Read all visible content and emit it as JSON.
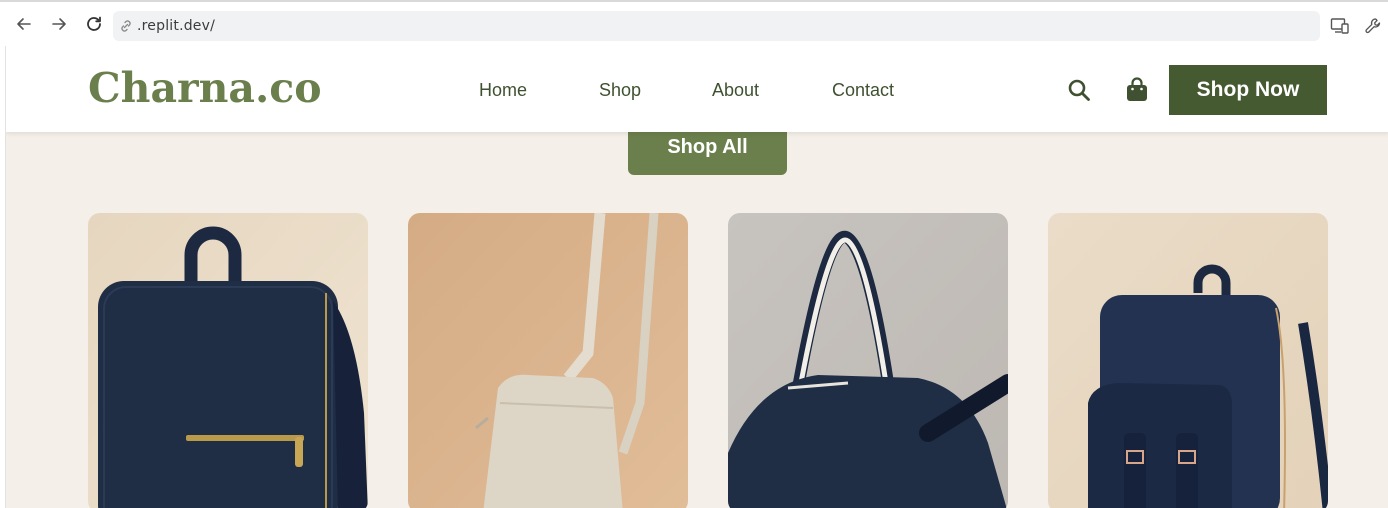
{
  "browser": {
    "url": ".replit.dev/",
    "icons": {
      "back": "arrow-left-icon",
      "forward": "arrow-right-icon",
      "reload": "reload-icon",
      "site_info": "link-icon",
      "device_toolbar": "device-toggle-icon",
      "devtools": "wrench-icon"
    }
  },
  "site": {
    "logo": "Charna.co",
    "nav": [
      "Home",
      "Shop",
      "About",
      "Contact"
    ],
    "icons": {
      "search": "search-icon",
      "cart": "shopping-bag-icon"
    },
    "cta": "Shop Now",
    "shop_all": "Shop All"
  },
  "products": [
    {
      "image": "navy-backpack-front"
    },
    {
      "image": "beige-crossbody-pouch"
    },
    {
      "image": "navy-tote-with-racket"
    },
    {
      "image": "navy-flap-backpack"
    }
  ],
  "colors": {
    "brand_green": "#6b7f4c",
    "dark_green": "#465a32",
    "nav_text": "#3f5131",
    "page_bg": "#f4efe8",
    "navy": "#1f2d45"
  }
}
